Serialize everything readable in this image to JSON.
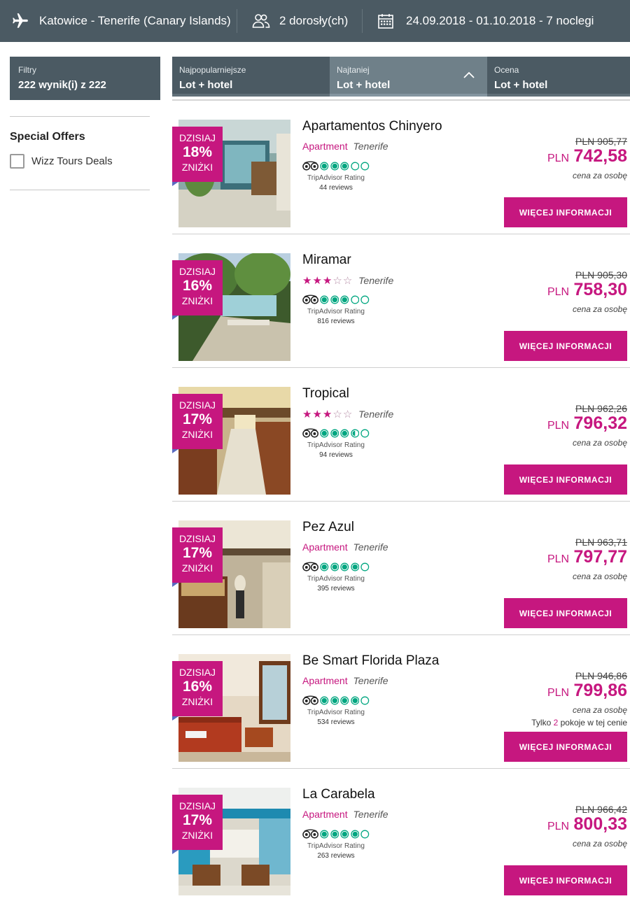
{
  "search": {
    "route": "Katowice - Tenerife (Canary Islands)",
    "passengers": "2 dorosły(ch)",
    "dates": "24.09.2018 - 01.10.2018 - 7 noclegi"
  },
  "sidebar": {
    "filters_label": "Filtry",
    "results_count": "222 wynik(i) z 222",
    "section_title": "Special Offers",
    "checkbox_label": "Wizz Tours Deals"
  },
  "sort_tabs": [
    {
      "small": "Najpopularniejsze",
      "big": "Lot + hotel"
    },
    {
      "small": "Najtaniej",
      "big": "Lot + hotel"
    },
    {
      "small": "Ocena",
      "big": "Lot + hotel"
    }
  ],
  "common": {
    "badge_today": "DZISIAJ",
    "badge_discount": "ZNIŻKI",
    "ta_label": "TripAdvisor Rating",
    "per_person": "cena za osobę",
    "button": "WIĘCEJ INFORMACJI",
    "currency": "PLN"
  },
  "hotels": [
    {
      "name": "Apartamentos Chinyero",
      "type": "Apartment",
      "stars": 0,
      "location": "Tenerife",
      "discount": "18%",
      "ta_rating": 3,
      "reviews": "44 reviews",
      "old_price": "PLN 905,77",
      "new_price": "742,58",
      "rooms_note": null
    },
    {
      "name": "Miramar",
      "type": "",
      "stars": 3,
      "location": "Tenerife",
      "discount": "16%",
      "ta_rating": 3,
      "reviews": "816 reviews",
      "old_price": "PLN 905,30",
      "new_price": "758,30",
      "rooms_note": null
    },
    {
      "name": "Tropical",
      "type": "",
      "stars": 3,
      "location": "Tenerife",
      "discount": "17%",
      "ta_rating": 3.5,
      "reviews": "94 reviews",
      "old_price": "PLN 962,26",
      "new_price": "796,32",
      "rooms_note": null
    },
    {
      "name": "Pez Azul",
      "type": "Apartment",
      "stars": 0,
      "location": "Tenerife",
      "discount": "17%",
      "ta_rating": 4,
      "reviews": "395 reviews",
      "old_price": "PLN 963,71",
      "new_price": "797,77",
      "rooms_note": null
    },
    {
      "name": "Be Smart Florida Plaza",
      "type": "Apartment",
      "stars": 0,
      "location": "Tenerife",
      "discount": "16%",
      "ta_rating": 4,
      "reviews": "534 reviews",
      "old_price": "PLN 946,86",
      "new_price": "799,86",
      "rooms_note": {
        "before": "Tylko ",
        "num": "2",
        "after": " pokoje w tej cenie"
      }
    },
    {
      "name": "La Carabela",
      "type": "Apartment",
      "stars": 0,
      "location": "Tenerife",
      "discount": "17%",
      "ta_rating": 4,
      "reviews": "263 reviews",
      "old_price": "PLN 966,42",
      "new_price": "800,33",
      "rooms_note": null
    }
  ],
  "colors": {
    "brand": "#c6177f",
    "header": "#4b5a63",
    "tripadvisor": "#00a680"
  }
}
